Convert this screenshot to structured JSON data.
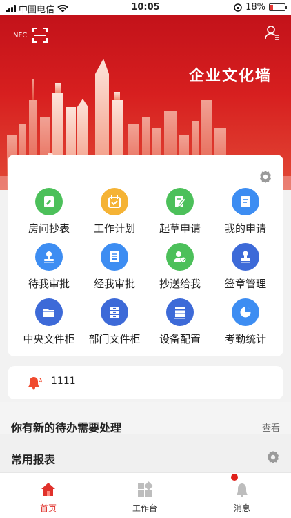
{
  "status_bar": {
    "carrier": "中国电信",
    "time": "10:05",
    "battery": "18%",
    "battery_level": 0.18
  },
  "header": {
    "nfc_label": "NFC",
    "slogan": "企业文化墙"
  },
  "grid": [
    {
      "label": "房间抄表",
      "icon": "meter-reading-icon",
      "color": "#4cc05a"
    },
    {
      "label": "工作计划",
      "icon": "calendar-check-icon",
      "color": "#f5b335"
    },
    {
      "label": "起草申请",
      "icon": "draft-edit-icon",
      "color": "#4cc05a"
    },
    {
      "label": "我的申请",
      "icon": "my-application-icon",
      "color": "#3d8df2"
    },
    {
      "label": "待我审批",
      "icon": "stamp-icon",
      "color": "#3d8df2"
    },
    {
      "label": "经我审批",
      "icon": "approved-document-icon",
      "color": "#3d8df2"
    },
    {
      "label": "抄送给我",
      "icon": "cc-user-icon",
      "color": "#4cc05a"
    },
    {
      "label": "签章管理",
      "icon": "seal-icon",
      "color": "#3d6ad8"
    },
    {
      "label": "中央文件柜",
      "icon": "folder-icon",
      "color": "#3d6ad8"
    },
    {
      "label": "部门文件柜",
      "icon": "cabinet-icon",
      "color": "#3d6ad8"
    },
    {
      "label": "设备配置",
      "icon": "server-icon",
      "color": "#3d6ad8"
    },
    {
      "label": "考勤统计",
      "icon": "pie-chart-icon",
      "color": "#3d8df2"
    }
  ],
  "notice": {
    "text": "1111"
  },
  "todo": {
    "title": "你有新的待办需要处理",
    "more": "查看"
  },
  "reports": {
    "title": "常用报表"
  },
  "tabs": [
    {
      "label": "首页",
      "active": true
    },
    {
      "label": "工作台",
      "active": false
    },
    {
      "label": "消息",
      "active": false,
      "badge": true
    }
  ],
  "colors": {
    "brand": "#d71f1f",
    "active_tab": "#e0312b"
  }
}
